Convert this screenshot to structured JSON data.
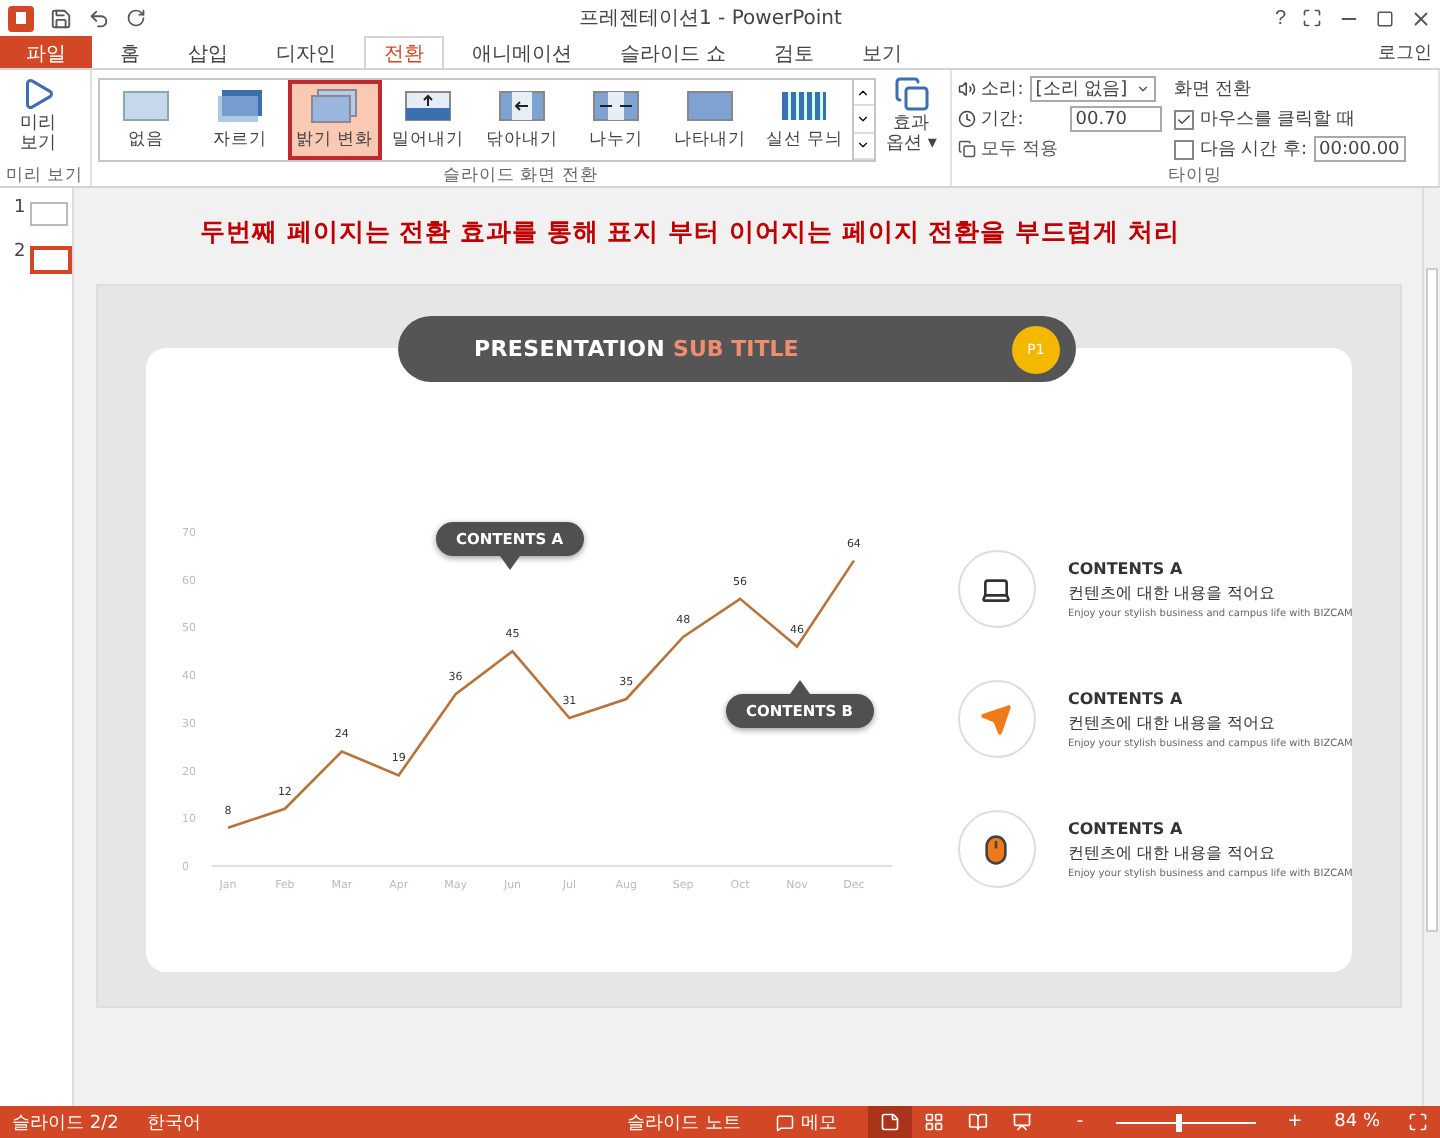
{
  "window": {
    "title": "프레젠테이션1 - PowerPoint",
    "help": "?"
  },
  "ribbon_tabs": [
    {
      "label": "파일",
      "kind": "file",
      "selected": false
    },
    {
      "label": "홈",
      "kind": "tab",
      "selected": false
    },
    {
      "label": "삽입",
      "kind": "tab",
      "selected": false
    },
    {
      "label": "디자인",
      "kind": "tab",
      "selected": false
    },
    {
      "label": "전환",
      "kind": "tab",
      "selected": true
    },
    {
      "label": "애니메이션",
      "kind": "tab",
      "selected": false
    },
    {
      "label": "슬라이드 쇼",
      "kind": "tab",
      "selected": false
    },
    {
      "label": "검토",
      "kind": "tab",
      "selected": false
    },
    {
      "label": "보기",
      "kind": "tab",
      "selected": false
    }
  ],
  "account": "로그인",
  "preview_group": {
    "button": "미리 보기",
    "label": "미리 보기"
  },
  "transitions_group": {
    "label": "슬라이드 화면 전환",
    "effect_options": "효과 옵션 ▾",
    "items": [
      {
        "label": "없음",
        "kind": "plain",
        "selected": false
      },
      {
        "label": "자르기",
        "kind": "cut",
        "selected": false
      },
      {
        "label": "밝기 변화",
        "kind": "fade",
        "selected": true
      },
      {
        "label": "밀어내기",
        "kind": "push",
        "selected": false
      },
      {
        "label": "닦아내기",
        "kind": "wipe",
        "selected": false
      },
      {
        "label": "나누기",
        "kind": "split",
        "selected": false
      },
      {
        "label": "나타내기",
        "kind": "reveal",
        "selected": false
      },
      {
        "label": "실선 무늬",
        "kind": "bars",
        "selected": false
      }
    ]
  },
  "timing_group": {
    "label": "타이밍",
    "sound_label": "소리:",
    "sound_value": "[소리 없음]",
    "duration_label": "기간:",
    "duration_value": "00.70",
    "apply_all": "모두 적용",
    "advance_title": "화면 전환",
    "on_click": {
      "label": "마우스를 클릭할 때",
      "checked": true
    },
    "after_time": {
      "label": "다음 시간 후:",
      "checked": false,
      "value": "00:00.00"
    }
  },
  "thumbnails": [
    {
      "number": "1",
      "selected": false
    },
    {
      "number": "2",
      "selected": true
    }
  ],
  "heading": "두번째 페이지는 전환 효과를 통해 표지 부터 이어지는 페이지 전환을 부드럽게 처리",
  "slide": {
    "title_main": "PRESENTATION",
    "title_accent": "SUB TITLE",
    "page_badge": "P1",
    "chart_data": {
      "type": "line",
      "categories": [
        "Jan",
        "Feb",
        "Mar",
        "Apr",
        "May",
        "Jun",
        "Jul",
        "Aug",
        "Sep",
        "Oct",
        "Nov",
        "Dec"
      ],
      "series": [
        {
          "color": "#b8733a",
          "values": [
            8,
            12,
            24,
            19,
            36,
            45,
            31,
            35,
            48,
            56,
            46,
            64
          ]
        }
      ],
      "ylim": [
        0,
        70
      ],
      "yticks": [
        0,
        10,
        20,
        30,
        40,
        50,
        60,
        70
      ],
      "data_labels": true
    },
    "callouts": [
      {
        "label": "CONTENTS A",
        "kind": "down"
      },
      {
        "label": "CONTENTS B",
        "kind": "up"
      }
    ],
    "items": [
      {
        "kind": "laptop",
        "title": "CONTENTS A",
        "subtitle": "컨텐츠에 대한 내용을 적어요",
        "caption": "Enjoy your stylish business and campus life with BIZCAM"
      },
      {
        "kind": "plane",
        "title": "CONTENTS A",
        "subtitle": "컨텐츠에 대한 내용을 적어요",
        "caption": "Enjoy your stylish business and campus life with BIZCAM"
      },
      {
        "kind": "mouse",
        "title": "CONTENTS A",
        "subtitle": "컨텐츠에 대한 내용을 적어요",
        "caption": "Enjoy your stylish business and campus life with BIZCAM"
      }
    ]
  },
  "status_bar": {
    "slide": "슬라이드 2/2",
    "language": "한국어",
    "notes": "슬라이드 노트",
    "comments": "메모",
    "views": [
      {
        "kind": "normal",
        "selected": true
      },
      {
        "kind": "sorter",
        "selected": false
      },
      {
        "kind": "reading",
        "selected": false
      },
      {
        "kind": "show",
        "selected": false
      }
    ],
    "zoom_minus": "-",
    "zoom_plus": "+",
    "zoom": {
      "level": 0.45
    },
    "zoom_value": "84 %"
  }
}
